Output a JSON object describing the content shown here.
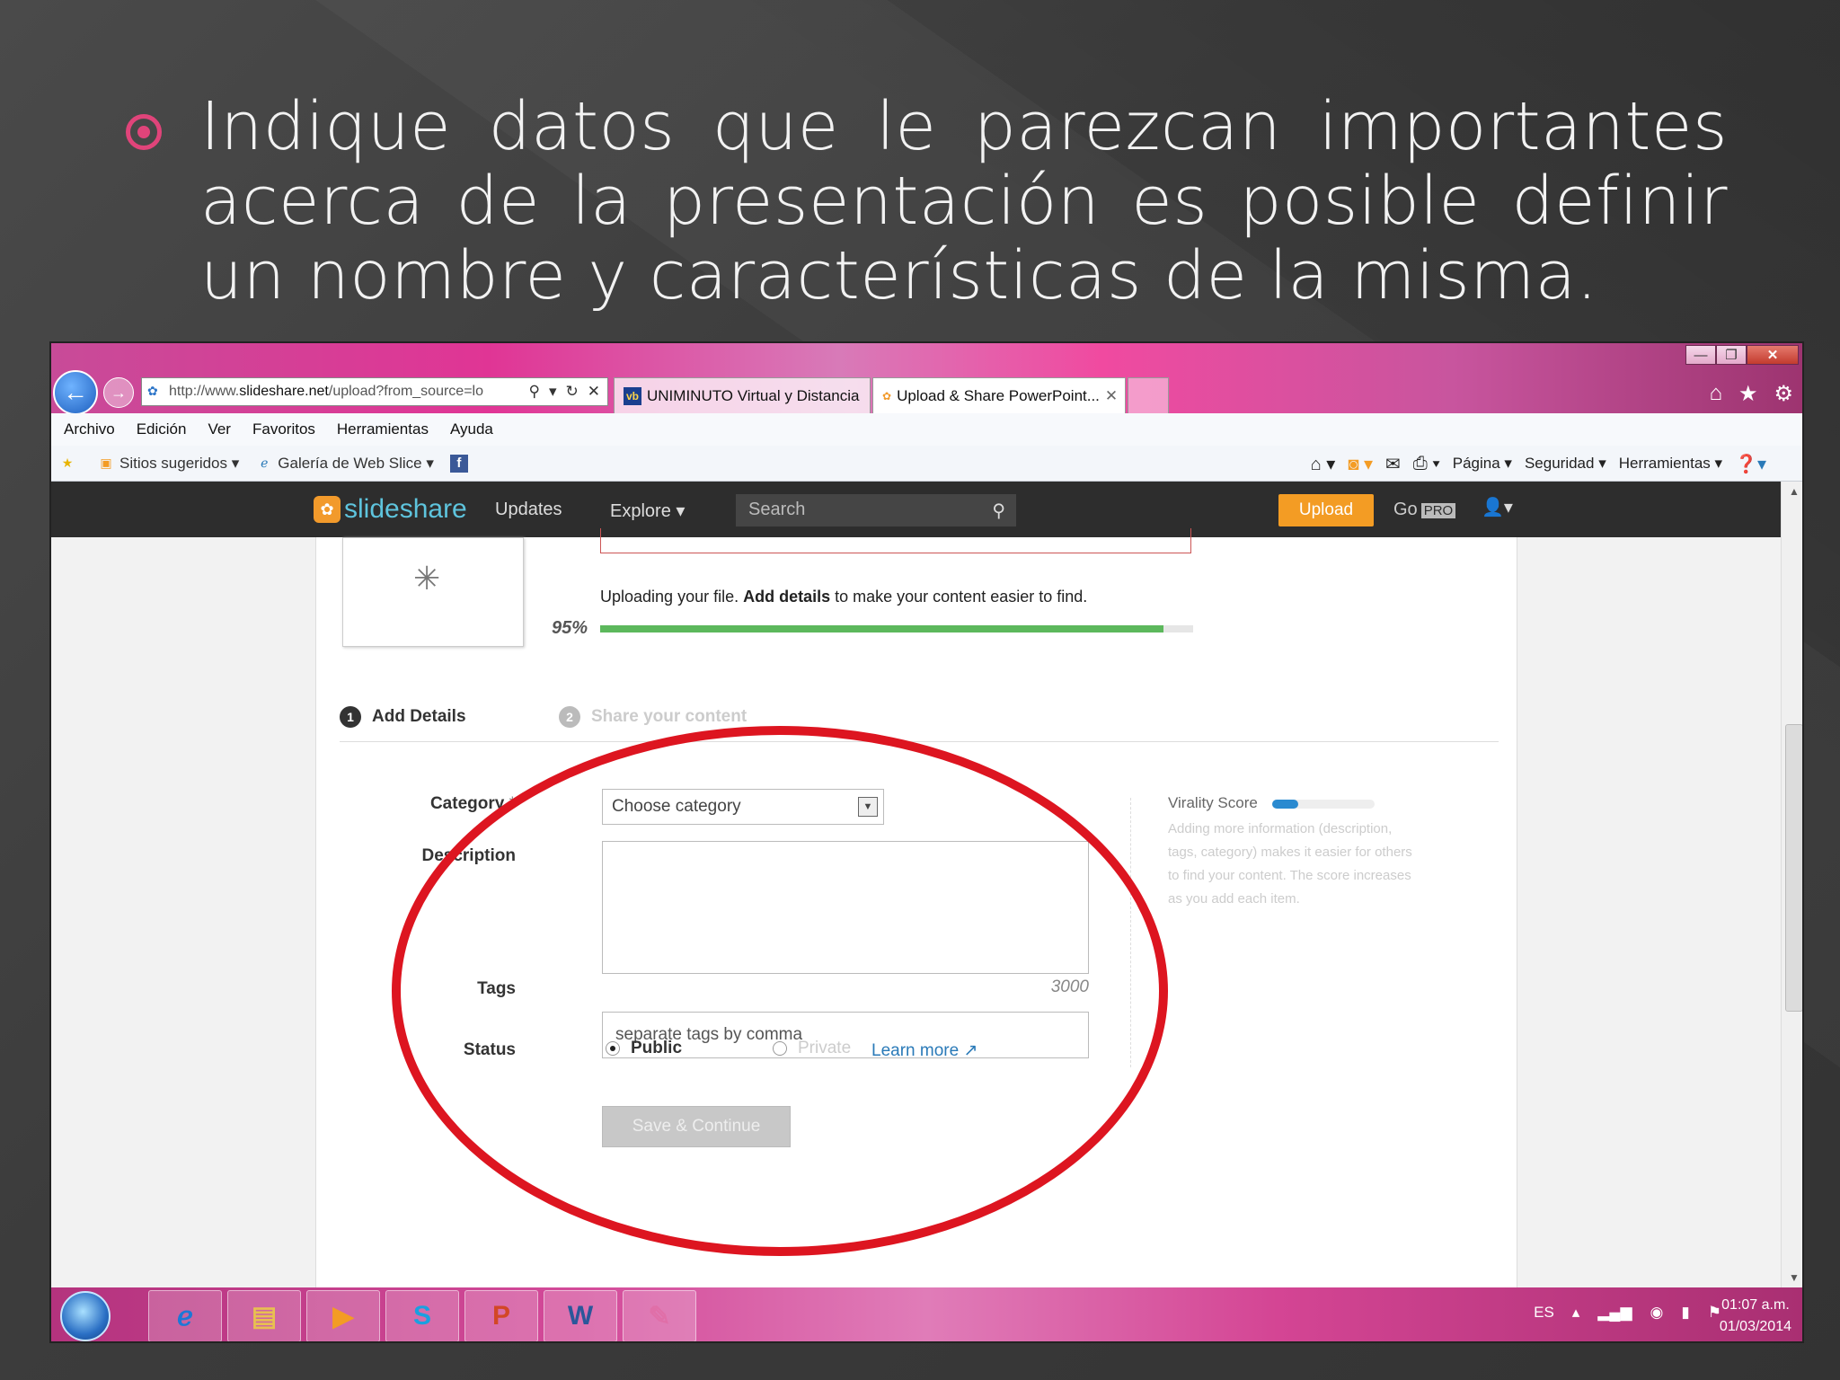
{
  "slide": {
    "heading": "Indique datos que le parezcan importantes acerca de la presentación es posible definir un nombre y características de la misma."
  },
  "browser": {
    "url_prefix": "http://www.",
    "url_domain": "slideshare.net",
    "url_path": "/upload?from_source=lo",
    "tabs": [
      {
        "label": "UNIMINUTO Virtual y Distancia"
      },
      {
        "label": "Upload & Share PowerPoint..."
      }
    ],
    "menu": [
      "Archivo",
      "Edición",
      "Ver",
      "Favoritos",
      "Herramientas",
      "Ayuda"
    ],
    "favorites": [
      "Sitios sugeridos",
      "Galería de Web Slice"
    ],
    "commands": [
      "Página",
      "Seguridad",
      "Herramientas"
    ]
  },
  "slideshare": {
    "logo": "slideshare",
    "nav": {
      "updates": "Updates",
      "explore": "Explore"
    },
    "search_placeholder": "Search",
    "upload": "Upload",
    "go": "Go",
    "pro": "PRO"
  },
  "upload": {
    "message_pre": "Uploading your file. ",
    "message_bold": "Add details",
    "message_post": " to make your content easier to find.",
    "percent_label": "95%",
    "progress_fraction": 0.95,
    "steps": [
      {
        "num": "1",
        "label": "Add Details"
      },
      {
        "num": "2",
        "label": "Share your content"
      }
    ]
  },
  "form": {
    "category_label": "Category",
    "category_required": "*",
    "category_value": "Choose category",
    "description_label": "Description",
    "description_counter": "3000",
    "tags_label": "Tags",
    "tags_placeholder": "separate tags by comma",
    "status_label": "Status",
    "status_public": "Public",
    "status_private": "Private",
    "learn_more": "Learn more",
    "save_button": "Save & Continue"
  },
  "virality": {
    "title": "Virality Score",
    "text": "Adding more information (description, tags, category) makes it easier for others to find your content. The score increases as you add each item."
  },
  "taskbar": {
    "lang": "ES",
    "time": "01:07 a.m.",
    "date": "01/03/2014"
  },
  "colors": {
    "accent_pink": "#e0447a",
    "annotation_red": "#dd1520",
    "slideshare_orange": "#f39c24",
    "progress_green": "#5cb85c"
  }
}
